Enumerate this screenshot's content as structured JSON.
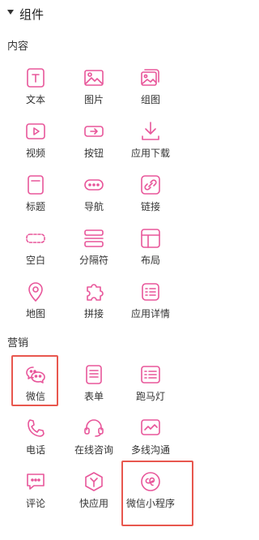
{
  "panel": {
    "title": "组件"
  },
  "sections": {
    "content": {
      "title": "内容",
      "items": [
        {
          "label": "文本",
          "icon": "text-icon"
        },
        {
          "label": "图片",
          "icon": "image-icon"
        },
        {
          "label": "组图",
          "icon": "gallery-icon"
        },
        {
          "label": "视频",
          "icon": "video-icon"
        },
        {
          "label": "按钮",
          "icon": "button-icon"
        },
        {
          "label": "应用下载",
          "icon": "download-icon"
        },
        {
          "label": "标题",
          "icon": "title-icon"
        },
        {
          "label": "导航",
          "icon": "nav-icon"
        },
        {
          "label": "链接",
          "icon": "link-icon"
        },
        {
          "label": "空白",
          "icon": "blank-icon"
        },
        {
          "label": "分隔符",
          "icon": "divider-icon"
        },
        {
          "label": "布局",
          "icon": "layout-icon"
        },
        {
          "label": "地图",
          "icon": "map-pin-icon"
        },
        {
          "label": "拼接",
          "icon": "puzzle-icon"
        },
        {
          "label": "应用详情",
          "icon": "app-detail-icon"
        }
      ]
    },
    "marketing": {
      "title": "营销",
      "items": [
        {
          "label": "微信",
          "icon": "wechat-icon"
        },
        {
          "label": "表单",
          "icon": "form-icon"
        },
        {
          "label": "跑马灯",
          "icon": "marquee-icon"
        },
        {
          "label": "电话",
          "icon": "phone-icon"
        },
        {
          "label": "在线咨询",
          "icon": "headset-icon"
        },
        {
          "label": "多线沟通",
          "icon": "multi-channel-icon"
        },
        {
          "label": "评论",
          "icon": "comment-icon"
        },
        {
          "label": "快应用",
          "icon": "quick-app-icon"
        },
        {
          "label": "微信小程序",
          "icon": "mini-program-icon"
        }
      ]
    }
  },
  "colors": {
    "accent": "#e8569a",
    "highlight": "#e8574e"
  }
}
